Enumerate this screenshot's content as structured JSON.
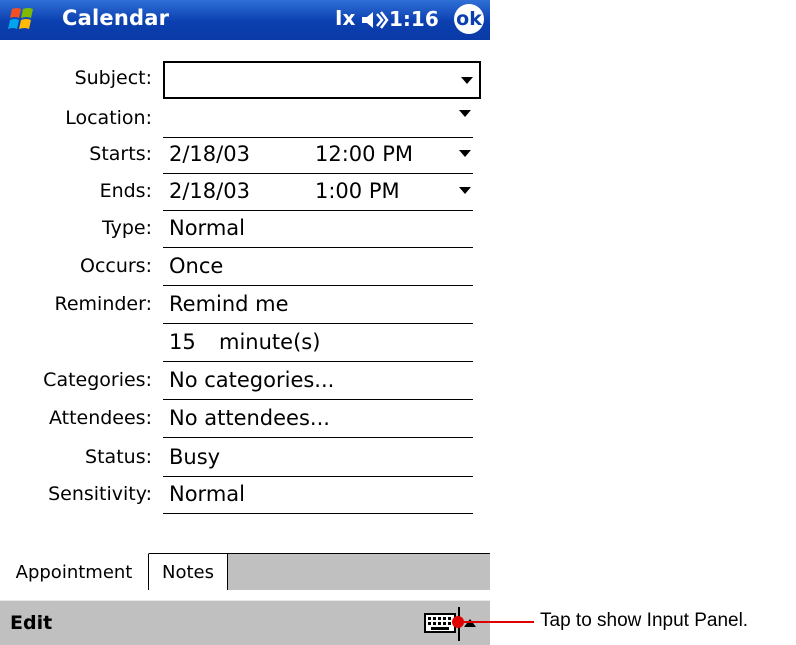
{
  "titlebar": {
    "app_title": "Calendar",
    "connectivity": "Ⅰx",
    "clock": "1:16",
    "ok_label": "ok",
    "icons": [
      "windows-start-icon",
      "connectivity-icon",
      "speaker-icon"
    ]
  },
  "form": {
    "subject": {
      "label": "Subject:",
      "value": ""
    },
    "location": {
      "label": "Location:",
      "value": ""
    },
    "starts": {
      "label": "Starts:",
      "date": "2/18/03",
      "time": "12:00 PM"
    },
    "ends": {
      "label": "Ends:",
      "date": "2/18/03",
      "time": "1:00 PM"
    },
    "type": {
      "label": "Type:",
      "value": "Normal"
    },
    "occurs": {
      "label": "Occurs:",
      "value": "Once"
    },
    "reminder": {
      "label": "Reminder:",
      "value": "Remind me",
      "amount": "15",
      "unit": "minute(s)"
    },
    "categories": {
      "label": "Categories:",
      "value": "No categories..."
    },
    "attendees": {
      "label": "Attendees:",
      "value": "No attendees..."
    },
    "status": {
      "label": "Status:",
      "value": "Busy"
    },
    "sensitivity": {
      "label": "Sensitivity:",
      "value": "Normal"
    }
  },
  "tabs": [
    {
      "label": "Appointment",
      "active": true
    },
    {
      "label": "Notes",
      "active": false
    }
  ],
  "cmdbar": {
    "edit_label": "Edit",
    "icons": [
      "keyboard-icon",
      "sip-arrow-icon"
    ]
  },
  "callout": {
    "text": "Tap to show Input Panel."
  },
  "colors": {
    "titlebar": "#0b3fb0",
    "bar_gray": "#c0c0c0",
    "callout": "#e00000"
  }
}
